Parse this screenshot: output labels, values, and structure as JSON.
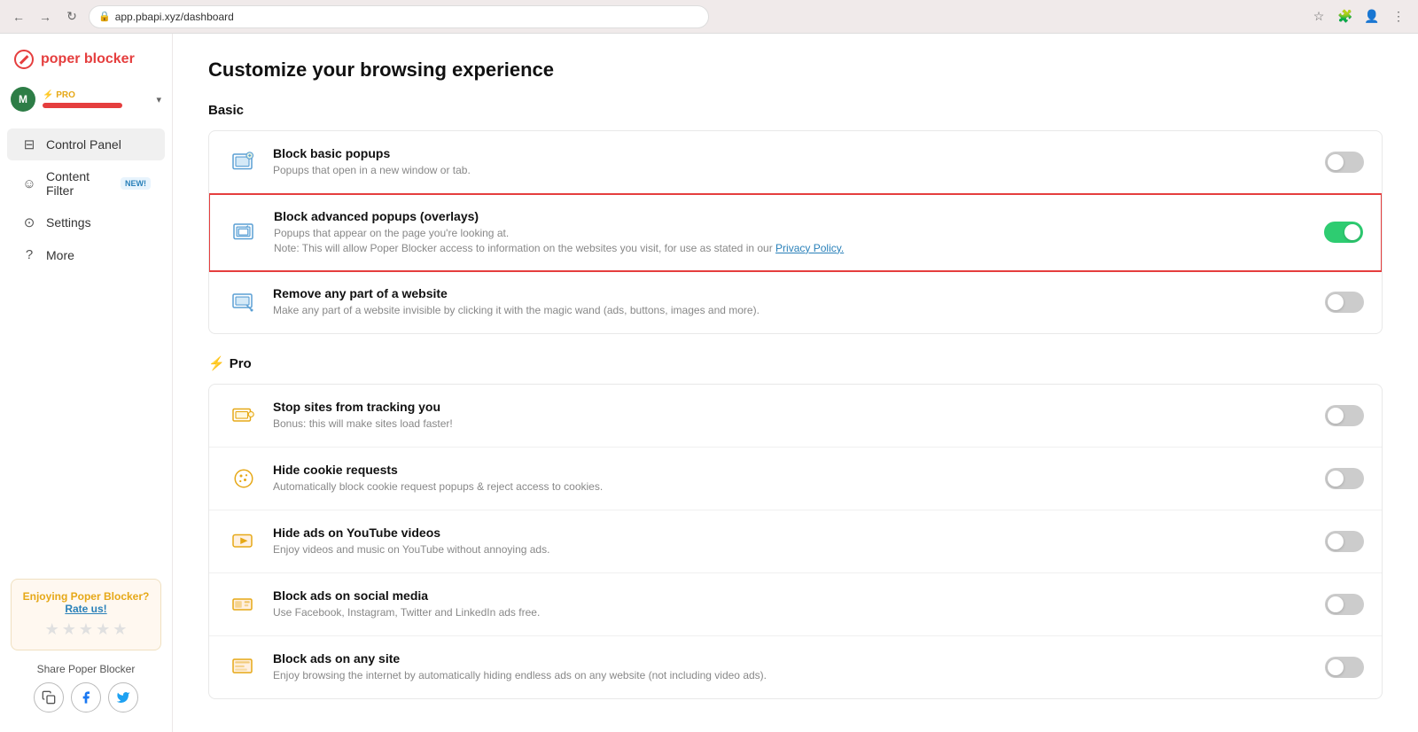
{
  "browser": {
    "url": "app.pbapi.xyz/dashboard",
    "back_label": "←",
    "forward_label": "→",
    "reload_label": "↻"
  },
  "sidebar": {
    "logo_text": "poper blocker",
    "user": {
      "avatar_letter": "M",
      "pro_label": "⚡ PRO",
      "chevron": "▾"
    },
    "nav": [
      {
        "id": "control-panel",
        "label": "Control Panel",
        "icon": "⊟",
        "active": true
      },
      {
        "id": "content-filter",
        "label": "Content Filter",
        "icon": "☺",
        "active": false,
        "badge": "NEW!"
      },
      {
        "id": "settings",
        "label": "Settings",
        "icon": "⊙",
        "active": false
      },
      {
        "id": "more",
        "label": "More",
        "icon": "?",
        "active": false
      }
    ],
    "rate_card": {
      "title": "Enjoying Poper Blocker?",
      "link": "Rate us!",
      "stars": [
        "★",
        "★",
        "★",
        "★",
        "★"
      ]
    },
    "share": {
      "title": "Share Poper Blocker",
      "icons": [
        "copy",
        "facebook",
        "twitter"
      ]
    }
  },
  "main": {
    "page_title": "Customize your browsing experience",
    "basic_section": {
      "label": "Basic",
      "features": [
        {
          "id": "block-basic-popups",
          "title": "Block basic popups",
          "desc": "Popups that open in a new window or tab.",
          "on": false,
          "highlighted": false
        },
        {
          "id": "block-advanced-popups",
          "title": "Block advanced popups (overlays)",
          "desc": "Popups that appear on the page you're looking at.",
          "note": "Note: This will allow Poper Blocker access to information on the websites you visit, for use as stated in our",
          "note_link": "Privacy Policy.",
          "on": true,
          "highlighted": true
        },
        {
          "id": "remove-website-part",
          "title": "Remove any part of a website",
          "desc": "Make any part of a website invisible by clicking it with the magic wand (ads, buttons, images and more).",
          "on": false,
          "highlighted": false
        }
      ]
    },
    "pro_section": {
      "label": "Pro",
      "features": [
        {
          "id": "stop-tracking",
          "title": "Stop sites from tracking you",
          "desc": "Bonus: this will make sites load faster!",
          "on": false,
          "highlighted": false
        },
        {
          "id": "hide-cookie-requests",
          "title": "Hide cookie requests",
          "desc": "Automatically block cookie request popups & reject access to cookies.",
          "on": false,
          "highlighted": false
        },
        {
          "id": "hide-youtube-ads",
          "title": "Hide ads on YouTube videos",
          "desc": "Enjoy videos and music on YouTube without annoying ads.",
          "on": false,
          "highlighted": false
        },
        {
          "id": "block-social-media-ads",
          "title": "Block ads on social media",
          "desc": "Use Facebook, Instagram, Twitter and LinkedIn ads free.",
          "on": false,
          "highlighted": false
        },
        {
          "id": "block-any-site-ads",
          "title": "Block ads on any site",
          "desc": "Enjoy browsing the internet by automatically hiding endless ads on any website (not including video ads).",
          "on": false,
          "highlighted": false
        }
      ]
    }
  }
}
